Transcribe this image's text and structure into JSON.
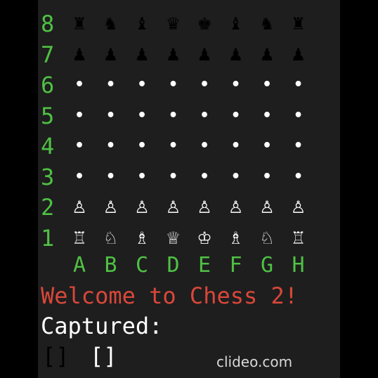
{
  "ranks": [
    "8",
    "7",
    "6",
    "5",
    "4",
    "3",
    "2",
    "1"
  ],
  "files": [
    "A",
    "B",
    "C",
    "D",
    "E",
    "F",
    "G",
    "H"
  ],
  "board": [
    [
      "♜",
      "♞",
      "♝",
      "♛",
      "♚",
      "♝",
      "♞",
      "♜"
    ],
    [
      "♟",
      "♟",
      "♟",
      "♟",
      "♟",
      "♟",
      "♟",
      "♟"
    ],
    [
      "•",
      "•",
      "•",
      "•",
      "•",
      "•",
      "•",
      "•"
    ],
    [
      "•",
      "•",
      "•",
      "•",
      "•",
      "•",
      "•",
      "•"
    ],
    [
      "•",
      "•",
      "•",
      "•",
      "•",
      "•",
      "•",
      "•"
    ],
    [
      "•",
      "•",
      "•",
      "•",
      "•",
      "•",
      "•",
      "•"
    ],
    [
      "♙",
      "♙",
      "♙",
      "♙",
      "♙",
      "♙",
      "♙",
      "♙"
    ],
    [
      "♖",
      "♘",
      "♗",
      "♕",
      "♔",
      "♗",
      "♘",
      "♖"
    ]
  ],
  "board_piece_names": [
    [
      "black-rook",
      "black-knight",
      "black-bishop",
      "black-queen",
      "black-king",
      "black-bishop",
      "black-knight",
      "black-rook"
    ],
    [
      "black-pawn",
      "black-pawn",
      "black-pawn",
      "black-pawn",
      "black-pawn",
      "black-pawn",
      "black-pawn",
      "black-pawn"
    ],
    [
      "empty",
      "empty",
      "empty",
      "empty",
      "empty",
      "empty",
      "empty",
      "empty"
    ],
    [
      "empty",
      "empty",
      "empty",
      "empty",
      "empty",
      "empty",
      "empty",
      "empty"
    ],
    [
      "empty",
      "empty",
      "empty",
      "empty",
      "empty",
      "empty",
      "empty",
      "empty"
    ],
    [
      "empty",
      "empty",
      "empty",
      "empty",
      "empty",
      "empty",
      "empty",
      "empty"
    ],
    [
      "white-pawn",
      "white-pawn",
      "white-pawn",
      "white-pawn",
      "white-pawn",
      "white-pawn",
      "white-pawn",
      "white-pawn"
    ],
    [
      "white-rook",
      "white-knight",
      "white-bishop",
      "white-queen",
      "white-king",
      "white-bishop",
      "white-knight",
      "white-rook"
    ]
  ],
  "welcome": "Welcome to Chess 2!",
  "captured_label": "Captured:",
  "captured_black": "[]",
  "captured_white": "[]",
  "watermark": "clideo.com",
  "colors": {
    "label_green": "#4fc144",
    "welcome_red": "#d9473a",
    "terminal_bg": "#1e1e1e",
    "frame_bg": "#000000"
  }
}
